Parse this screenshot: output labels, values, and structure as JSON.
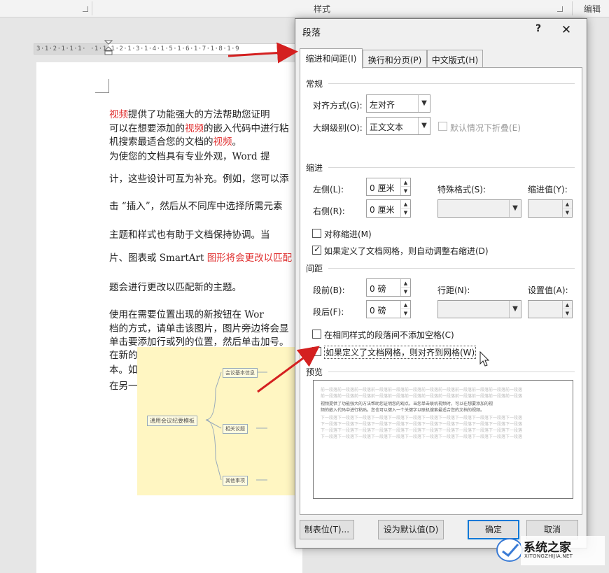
{
  "ribbon": {
    "group_styles": "样式",
    "group_edit": "编辑"
  },
  "ruler": {
    "ticks": "3·1·2·1·1·1·  ·1·1·1·2·1·3·1·4·1·5·1·6·1·7·1·8·1·9"
  },
  "document": {
    "lines": [
      {
        "segments": [
          {
            "t": "    ",
            "r": false
          },
          {
            "t": "视频",
            "r": true
          },
          {
            "t": "提供了功能强大的方法帮助您证明",
            "r": false
          }
        ]
      },
      {
        "segments": [
          {
            "t": "可以在想要添加的",
            "r": false
          },
          {
            "t": "视频",
            "r": true
          },
          {
            "t": "的嵌入代码中进行粘",
            "r": false
          }
        ]
      },
      {
        "segments": [
          {
            "t": "机搜索最适合您的文档的",
            "r": false
          },
          {
            "t": "视频",
            "r": true
          },
          {
            "t": "。",
            "r": false
          }
        ]
      },
      {
        "segments": [
          {
            "t": "    为使您的文档具有专业外观，Word 提",
            "r": false
          }
        ]
      },
      {
        "segments": [
          {
            "t": "计，这些设计可互为补充。例如，您可以添",
            "r": false
          }
        ]
      },
      {
        "segments": [
          {
            "t": "击 “插入”，然后从不同库中选择所需元素",
            "r": false
          }
        ]
      },
      {
        "segments": [
          {
            "t": "    主题和样式也有助于文档保持协调。当",
            "r": false
          }
        ]
      },
      {
        "segments": [
          {
            "t": "片、图表或 SmartArt ",
            "r": false
          },
          {
            "t": "图形将会更改以匹配",
            "r": true
          }
        ]
      },
      {
        "segments": [
          {
            "t": "题会进行更改以匹配新的主题。",
            "r": false
          }
        ]
      },
      {
        "segments": [
          {
            "t": "    使用在需要位置出现的新按钮在 Wor",
            "r": false
          }
        ]
      },
      {
        "segments": [
          {
            "t": "档的方式，请单击该图片，图片旁边将会显",
            "r": false
          }
        ]
      },
      {
        "segments": [
          {
            "t": "单击要添加行或列的位置，然后单击加号。",
            "r": false
          }
        ]
      },
      {
        "segments": [
          {
            "t": "    在新的阅读视图中阅读更加容易。可以",
            "r": false
          }
        ]
      },
      {
        "segments": [
          {
            "t": "本。如果在达到结尾处之前需要停止读取，",
            "r": false
          }
        ]
      },
      {
        "segments": [
          {
            "t": "在另一个设备上。",
            "r": false
          }
        ]
      }
    ],
    "mindmap": {
      "root": "通用会议纪要模板",
      "branches": [
        "会议基本信息",
        "相关议题",
        "其他事项"
      ]
    }
  },
  "dialog": {
    "title": "段落",
    "help": "?",
    "close": "✕",
    "tabs": [
      "缩进和间距(I)",
      "换行和分页(P)",
      "中文版式(H)"
    ],
    "general": {
      "heading": "常规",
      "alignment_label": "对齐方式(G):",
      "alignment_value": "左对齐",
      "outline_label": "大纲级别(O):",
      "outline_value": "正文文本",
      "collapsed_label": "默认情况下折叠(E)",
      "collapsed_checked": false
    },
    "indent": {
      "heading": "缩进",
      "left_label": "左侧(L):",
      "left_value": "0 厘米",
      "right_label": "右侧(R):",
      "right_value": "0 厘米",
      "special_label": "特殊格式(S):",
      "special_value": "",
      "by_label": "缩进值(Y):",
      "by_value": "",
      "mirror_label": "对称缩进(M)",
      "mirror_checked": false,
      "auto_adjust_label": "如果定义了文档网格，则自动调整右缩进(D)",
      "auto_adjust_checked": true
    },
    "spacing": {
      "heading": "间距",
      "before_label": "段前(B):",
      "before_value": "0 磅",
      "after_label": "段后(F):",
      "after_value": "0 磅",
      "line_label": "行距(N):",
      "line_value": "",
      "at_label": "设置值(A):",
      "at_value": "",
      "no_space_label": "在相同样式的段落间不添加空格(C)",
      "no_space_checked": false,
      "snap_grid_label": "如果定义了文档网格，则对齐到网格(W)",
      "snap_grid_checked": false
    },
    "preview": {
      "heading": "预览",
      "prev_para": "前一段落前一段落前一段落前一段落前一段落前一段落前一段落前一段落前一段落前一段落前一段落前一段落",
      "sample_1": "视频提供了功能强大的方法帮助您证明您的观点。当您单击联机视频时，可以在想要添加的视",
      "sample_2": "频的嵌入代码中进行粘贴。您也可以键入一个关键字以联机搜索最适合您的文档的视频。",
      "next_para": "下一段落下一段落下一段落下一段落下一段落下一段落下一段落下一段落下一段落下一段落下一段落下一段落"
    },
    "buttons": {
      "tabs": "制表位(T)...",
      "set_default": "设为默认值(D)",
      "ok": "确定",
      "cancel": "取消"
    }
  },
  "watermark": {
    "text": "系统之家",
    "sub": "XITONGZHIJIA.NET"
  },
  "colors": {
    "accent_red": "#e03030",
    "arrow_red": "#d42020",
    "ok_border": "#0078d7",
    "mindmap_bg": "#fff6c2"
  }
}
